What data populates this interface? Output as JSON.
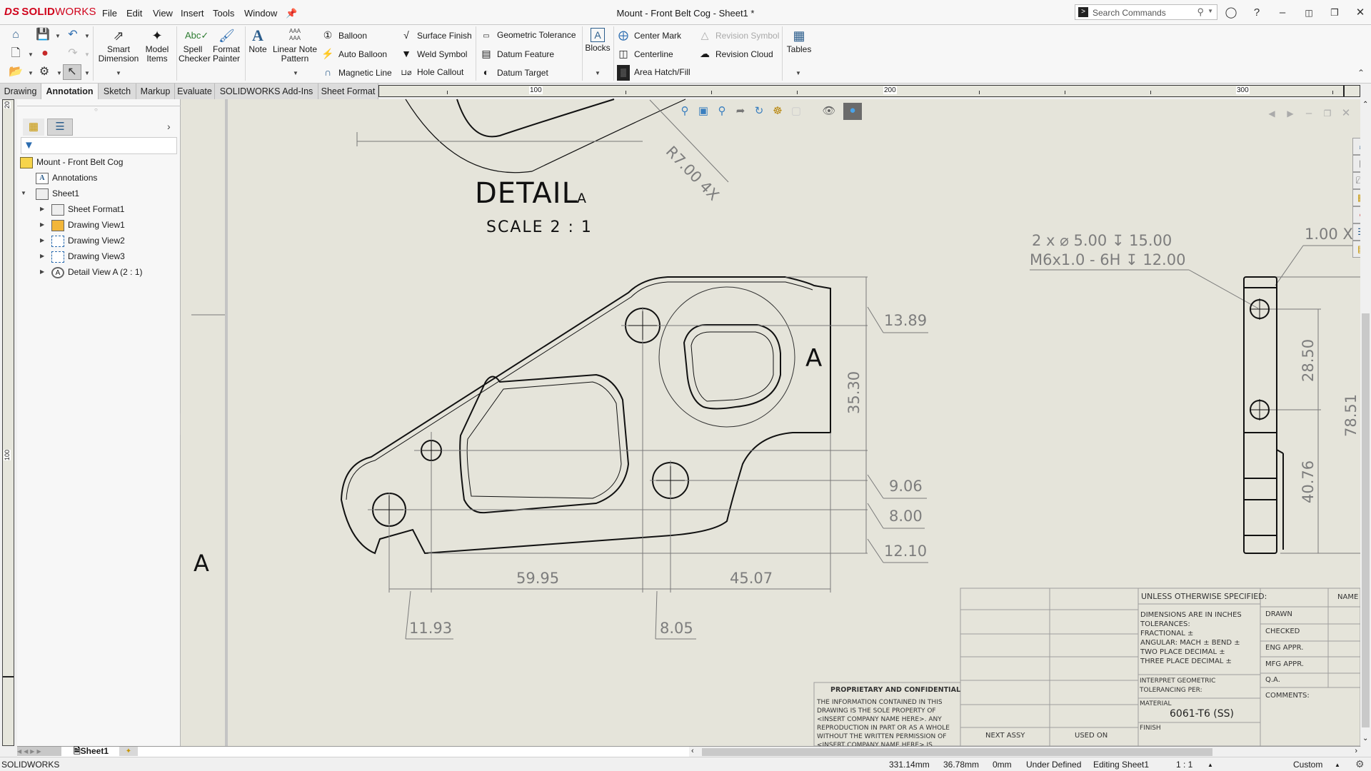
{
  "app": {
    "brand_prefix": "DS",
    "brand_solid": "SOLID",
    "brand_works": "WORKS",
    "document_title": "Mount - Front Belt Cog - Sheet1 *",
    "accent_color": "#d0021b"
  },
  "menu": [
    "File",
    "Edit",
    "View",
    "Insert",
    "Tools",
    "Window"
  ],
  "search": {
    "placeholder": "Search Commands"
  },
  "ribbon": {
    "big_buttons": [
      {
        "label": "Smart Dimension",
        "icon": "smart-dimension-icon"
      },
      {
        "label": "Model Items",
        "icon": "model-items-icon"
      },
      {
        "label": "Spell Checker",
        "icon": "spell-checker-icon"
      },
      {
        "label": "Format Painter",
        "icon": "format-painter-icon"
      },
      {
        "label": "Note",
        "icon": "note-icon"
      },
      {
        "label": "Linear Note Pattern",
        "icon": "linear-note-pattern-icon"
      },
      {
        "label": "Blocks",
        "icon": "blocks-icon"
      },
      {
        "label": "Tables",
        "icon": "tables-icon"
      }
    ],
    "small_buttons": [
      {
        "label": "Balloon",
        "icon": "balloon-icon"
      },
      {
        "label": "Auto Balloon",
        "icon": "auto-balloon-icon"
      },
      {
        "label": "Magnetic Line",
        "icon": "magnetic-line-icon"
      },
      {
        "label": "Surface Finish",
        "icon": "surface-finish-icon"
      },
      {
        "label": "Weld Symbol",
        "icon": "weld-symbol-icon"
      },
      {
        "label": "Hole Callout",
        "icon": "hole-callout-icon"
      },
      {
        "label": "Geometric Tolerance",
        "icon": "geometric-tolerance-icon"
      },
      {
        "label": "Datum Feature",
        "icon": "datum-feature-icon"
      },
      {
        "label": "Datum Target",
        "icon": "datum-target-icon"
      },
      {
        "label": "Center Mark",
        "icon": "center-mark-icon"
      },
      {
        "label": "Centerline",
        "icon": "centerline-icon"
      },
      {
        "label": "Area Hatch/Fill",
        "icon": "area-hatch-icon"
      },
      {
        "label": "Revision Symbol",
        "icon": "revision-symbol-icon",
        "disabled": true
      },
      {
        "label": "Revision Cloud",
        "icon": "revision-cloud-icon"
      }
    ]
  },
  "tabs": [
    {
      "label": "Drawing"
    },
    {
      "label": "Annotation",
      "active": true
    },
    {
      "label": "Sketch"
    },
    {
      "label": "Markup"
    },
    {
      "label": "Evaluate"
    },
    {
      "label": "SOLIDWORKS Add-Ins"
    },
    {
      "label": "Sheet Format"
    }
  ],
  "ruler": {
    "h_labels": [
      "100",
      "200",
      "300"
    ],
    "v_labels": [
      "20",
      "100"
    ]
  },
  "tree": {
    "root": "Mount - Front Belt Cog",
    "items": [
      {
        "label": "Annotations",
        "icon": "annotations-icon"
      },
      {
        "label": "Sheet1",
        "icon": "sheet-icon",
        "expanded": true
      },
      {
        "label": "Sheet Format1",
        "icon": "sheet-format-icon"
      },
      {
        "label": "Drawing View1",
        "icon": "drawing-view-icon"
      },
      {
        "label": "Drawing View2",
        "icon": "drawing-view-icon"
      },
      {
        "label": "Drawing View3",
        "icon": "drawing-view-icon"
      },
      {
        "label": "Detail View A (2 : 1)",
        "icon": "detail-view-icon"
      }
    ]
  },
  "drawing": {
    "detail_title": "DETAIL",
    "detail_letter": "A",
    "detail_scale": "SCALE 2 : 1",
    "radius_note": "R7.00 4X",
    "zone_letter": "A",
    "hole_callout_line1": "2 x ⌀ 5.00 ↧ 15.00",
    "hole_callout_line2": "M6x1.0 - 6H ↧ 12.00",
    "chamfer_note": "1.00 X",
    "dims": {
      "d1": "13.89",
      "d2": "35.30",
      "d3": "9.06",
      "d4": "8.00",
      "d5": "12.10",
      "d6": "59.95",
      "d7": "45.07",
      "d8": "11.93",
      "d9": "8.05",
      "d10": "28.50",
      "d11": "40.76",
      "d12": "78.51"
    }
  },
  "title_block": {
    "unless": "UNLESS OTHERWISE SPECIFIED:",
    "name_header": "NAME",
    "dims_in": "DIMENSIONS ARE IN INCHES",
    "tolerances": "TOLERANCES:",
    "fractional": "FRACTIONAL ±",
    "angular": "ANGULAR: MACH ±    BEND ±",
    "two_place": "TWO PLACE DECIMAL    ±",
    "three_place": "THREE PLACE DECIMAL  ±",
    "interpret1": "INTERPRET GEOMETRIC",
    "interpret2": "TOLERANCING PER:",
    "material_label": "MATERIAL",
    "material_value": "6061-T6 (SS)",
    "finish_label": "FINISH",
    "next_assy": "NEXT ASSY",
    "used_on": "USED ON",
    "roles": [
      "DRAWN",
      "CHECKED",
      "ENG APPR.",
      "MFG APPR.",
      "Q.A.",
      "COMMENTS:"
    ],
    "proprietary_title": "PROPRIETARY AND CONFIDENTIAL",
    "proprietary_lines": [
      "THE INFORMATION CONTAINED IN THIS",
      "DRAWING IS THE SOLE PROPERTY OF",
      "<INSERT COMPANY NAME HERE>.  ANY",
      "REPRODUCTION IN PART OR AS A WHOLE",
      "WITHOUT THE WRITTEN PERMISSION OF",
      "<INSERT COMPANY NAME HERE> IS"
    ]
  },
  "sheet_tabs": {
    "active": "Sheet1"
  },
  "status": {
    "app": "SOLIDWORKS",
    "x": "331.14mm",
    "y": "36.78mm",
    "z": "0mm",
    "state": "Under Defined",
    "mode": "Editing Sheet1",
    "scale": "1 : 1",
    "units": "Custom"
  }
}
